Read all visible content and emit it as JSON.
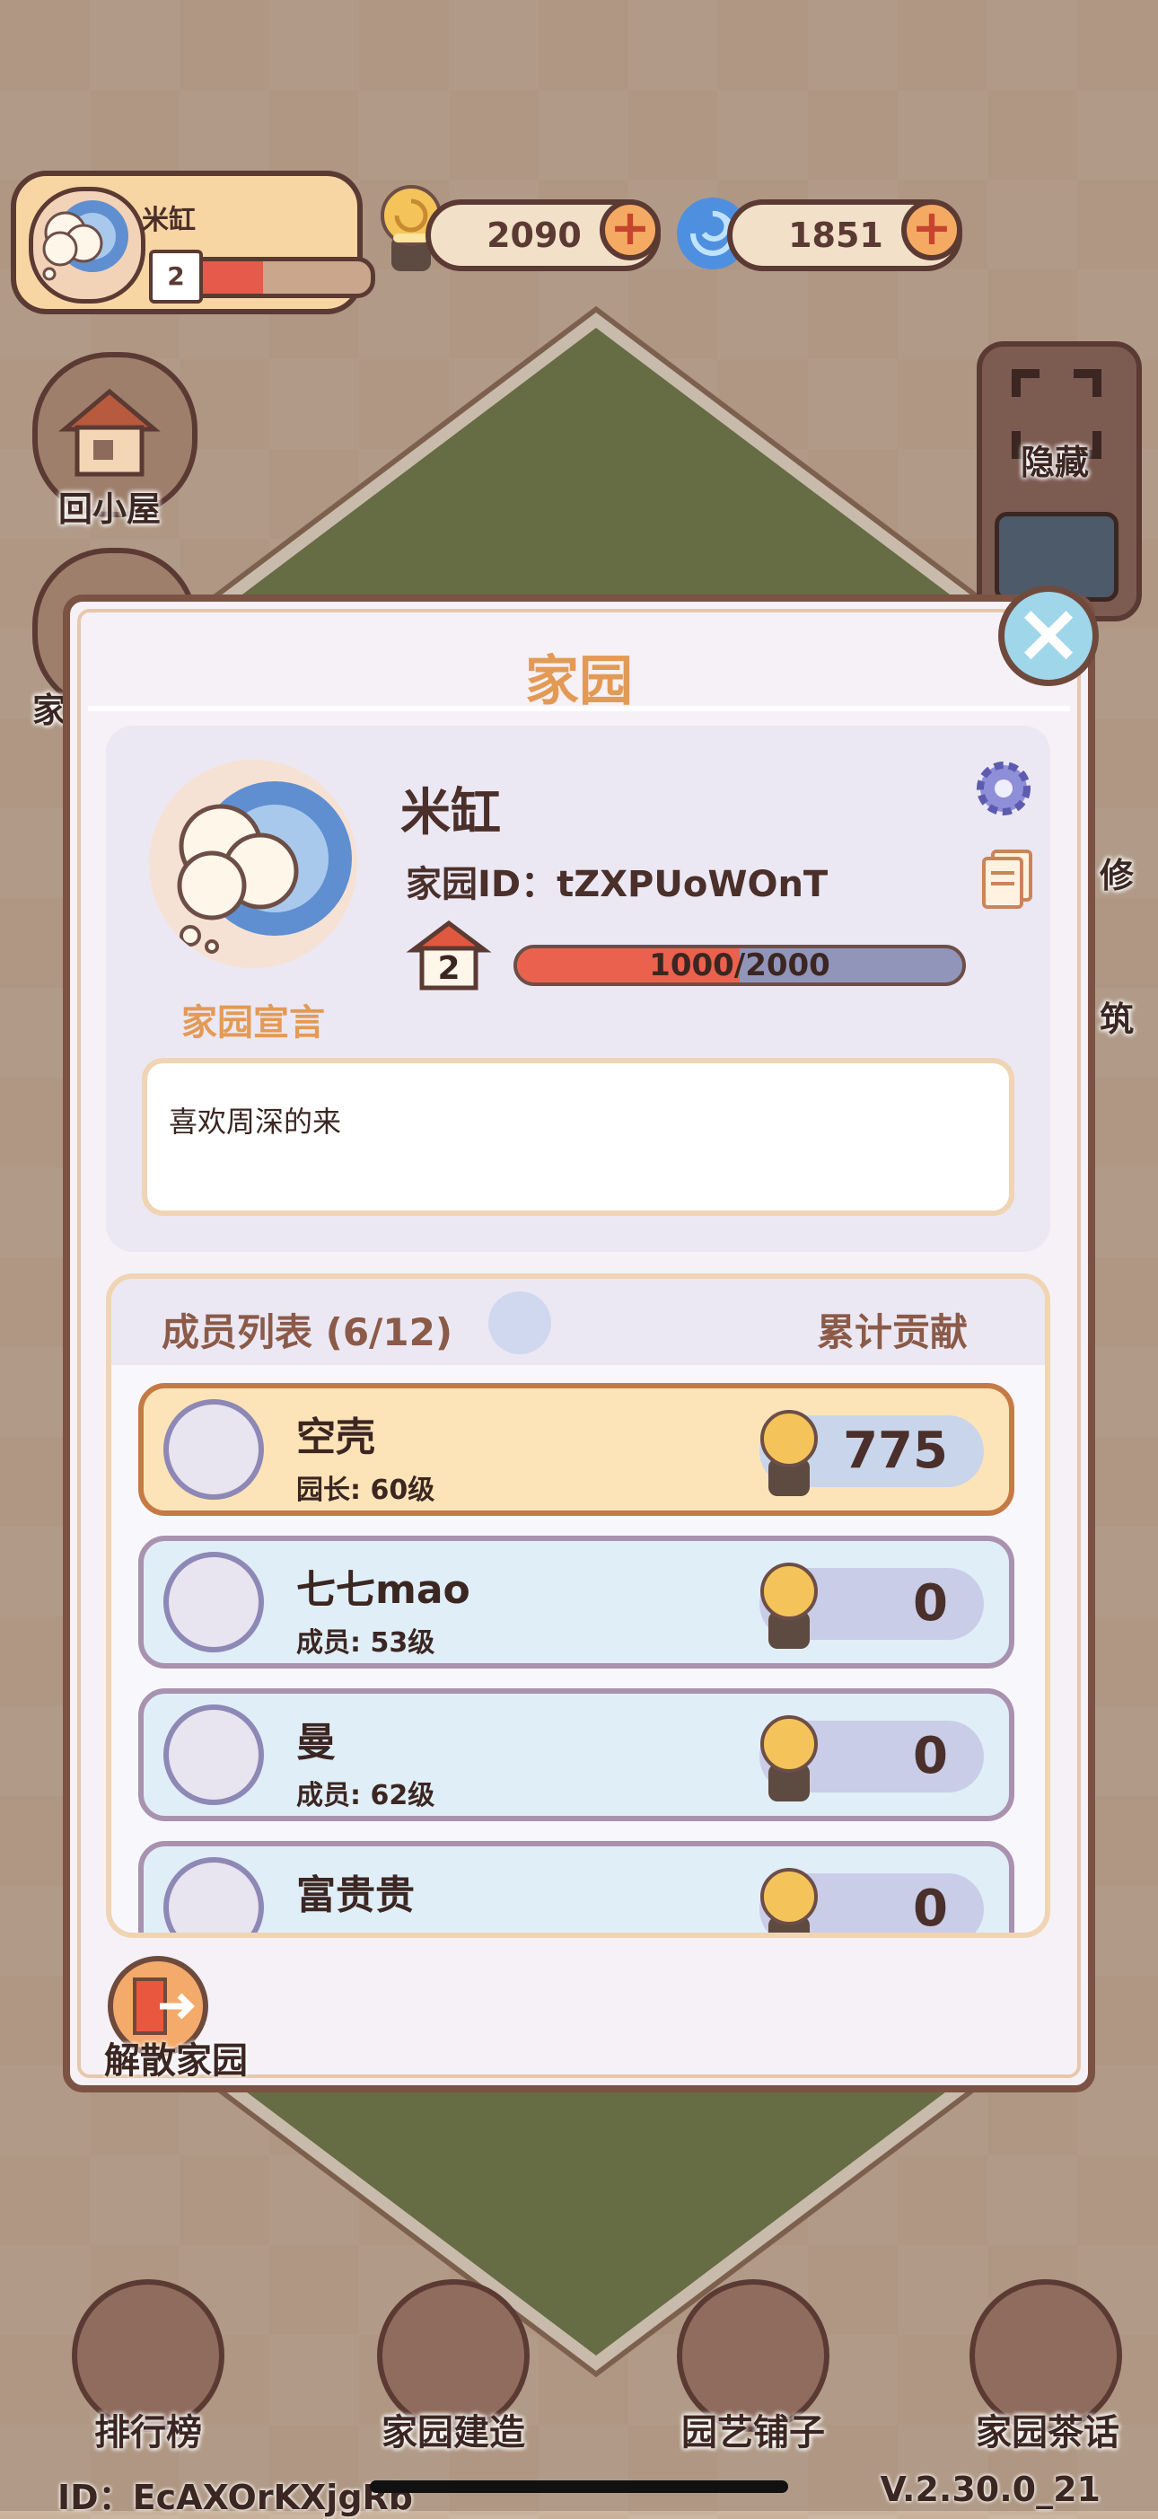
{
  "hud": {
    "player_name": "米缸",
    "level": "2",
    "snail_coins": "2090",
    "swirl_coins": "1851"
  },
  "side_left": [
    {
      "label": "回小屋",
      "icon": "house-icon"
    },
    {
      "label": "家",
      "icon": "home-garden-icon"
    }
  ],
  "side_right": [
    {
      "label": "隐藏",
      "icon": "hide-frame-icon"
    },
    {
      "label": "修",
      "icon": "repair-icon"
    },
    {
      "label": "筑",
      "icon": "build-icon"
    }
  ],
  "dialog": {
    "title": "家园",
    "home_name": "米缸",
    "home_id_label": "家园ID：tZXPUoWOnT",
    "level": "2",
    "progress_text": "1000/2000",
    "progress": 0.5,
    "declaration_label": "家园宣言",
    "declaration_text": "喜欢周深的来",
    "members_label": "成员列表 (6/12)",
    "contribution_label": "累计贡献",
    "members": [
      {
        "name": "空壳",
        "role": "园长: 60级",
        "value": "775",
        "avatar": "bear-avatar"
      },
      {
        "name": "七七mao",
        "role": "成员: 53级",
        "value": "0",
        "avatar": "bear-avatar"
      },
      {
        "name": "曼",
        "role": "成员: 62级",
        "value": "0",
        "avatar": "rabbit-avatar"
      },
      {
        "name": "富贵贵",
        "role": "",
        "value": "0",
        "avatar": "snail-avatar"
      }
    ],
    "dissolve_label": "解散家园"
  },
  "nav": [
    {
      "label": "排行榜",
      "icon": "leaderboard-icon"
    },
    {
      "label": "家园建造",
      "icon": "brick-trowel-icon"
    },
    {
      "label": "园艺铺子",
      "icon": "flower-basket-icon"
    },
    {
      "label": "家园茶话",
      "icon": "chat-bubbles-icon"
    }
  ],
  "footer": {
    "id": "ID：EcAXOrKXjgRb",
    "version": "V.2.30.0_21"
  },
  "colors": {
    "accent_orange": "#e39a55",
    "progress_red": "#ea624d",
    "border_brown": "#5b3a33"
  }
}
